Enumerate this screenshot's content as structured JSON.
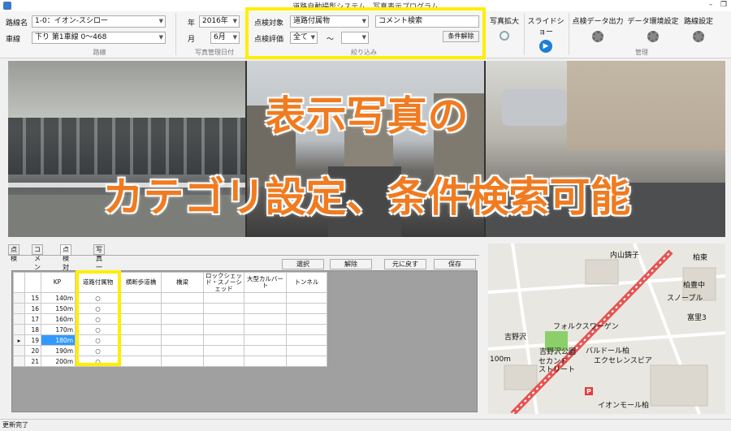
{
  "window": {
    "title": "道路自動撮影システム　写真表示プログラム"
  },
  "ribbon": {
    "route_label": "路線名",
    "route_value": "1-0：イオン-スシロー",
    "lane_label": "車線",
    "lane_value": "下り 第1車線 0～468",
    "group_route": "路線",
    "year_label": "年",
    "year_value": "2016年",
    "month_label": "月",
    "month_value": "6月",
    "group_date": "写真管理日付",
    "target_label": "点検対象",
    "target_value": "道路付属物",
    "eval_label": "点検評価",
    "eval_from": "全て",
    "eval_tilde": "～",
    "eval_to": "",
    "comment_search": "コメント検索",
    "clear_filter": "条件解除",
    "group_filter": "絞り込み",
    "photo_enlarge": "写真拡大",
    "slideshow": "スライドショー",
    "export": "点検データ出力",
    "env_settings": "データ環境設定",
    "route_settings": "路線設定",
    "group_manage": "管理"
  },
  "overlay": {
    "line1": "表示写真の",
    "line2": "カテゴリ設定、条件検索可能"
  },
  "tabs": [
    "点検",
    "コメント",
    "点検対象",
    "写真一覧"
  ],
  "toolbar": {
    "select": "選択",
    "release": "解除",
    "restore": "元に戻す",
    "save": "保存"
  },
  "grid": {
    "headers": [
      "KP",
      "道路付属物",
      "横断歩道橋",
      "橋梁",
      "ロックシェッド・スノーシェッド",
      "大型カルバート",
      "トンネル"
    ],
    "rows": [
      {
        "no": "15",
        "kp": "140m",
        "mark": "○"
      },
      {
        "no": "16",
        "kp": "150m",
        "mark": "○"
      },
      {
        "no": "17",
        "kp": "160m",
        "mark": "○"
      },
      {
        "no": "18",
        "kp": "170m",
        "mark": "○"
      },
      {
        "no": "19",
        "kp": "180m",
        "mark": "○"
      },
      {
        "no": "20",
        "kp": "190m",
        "mark": "○"
      },
      {
        "no": "21",
        "kp": "200m",
        "mark": "○"
      }
    ],
    "current_indicator": "▸"
  },
  "map": {
    "labels": [
      "内山鋳子",
      "柏東",
      "柏豊中",
      "スノープル",
      "富里3",
      "フォルクスワーゲン",
      "吉野沢",
      "吉野沢公園",
      "セカンド",
      "ストリート",
      "バルドール柏",
      "エクセレンスビア",
      "イオンモール柏",
      "P",
      "100m"
    ]
  },
  "status": {
    "text": "更新完了"
  }
}
